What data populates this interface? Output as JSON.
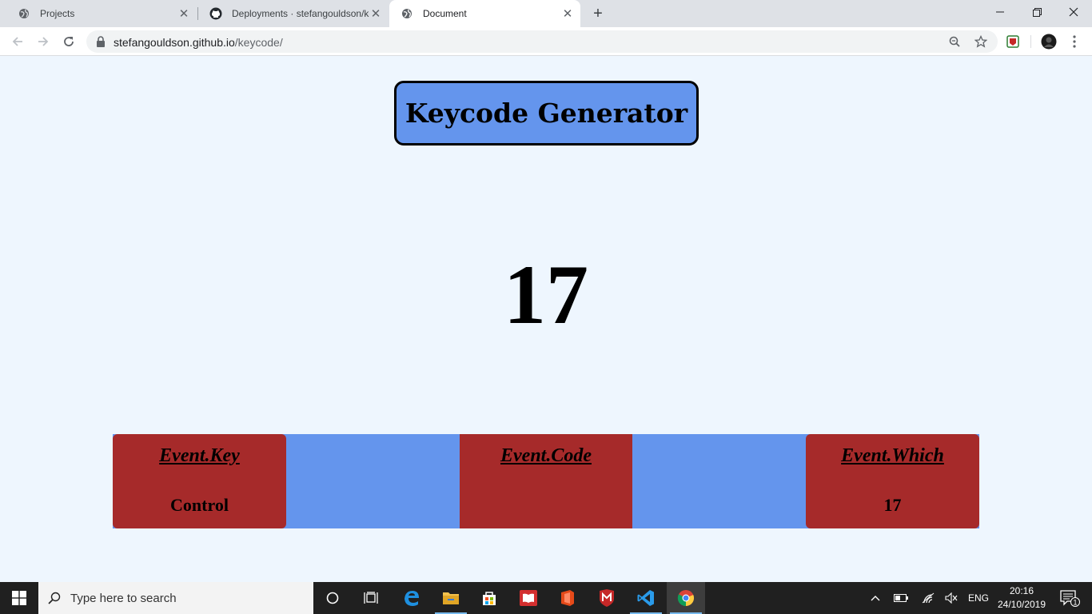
{
  "browser": {
    "tabs": [
      {
        "title": "Projects",
        "favicon": "globe-icon",
        "active": false
      },
      {
        "title": "Deployments · stefangouldson/keycode",
        "favicon": "github-icon",
        "active": false
      },
      {
        "title": "Document",
        "favicon": "globe-icon",
        "active": true
      }
    ],
    "new_tab_label": "+",
    "address": {
      "host": "stefangouldson.github.io",
      "path": "/keycode/"
    }
  },
  "page": {
    "heading": "Keycode Generator",
    "keycode": "17",
    "cards": [
      {
        "label": "Event.Key",
        "value": "Control"
      },
      {
        "label": "Event.Code",
        "value": ""
      },
      {
        "label": "Event.Which",
        "value": "17"
      }
    ],
    "colors": {
      "background": "#eef6fe",
      "accent_blue": "#6495ed",
      "card_red": "#a62a2a"
    }
  },
  "taskbar": {
    "search_placeholder": "Type here to search",
    "apps": [
      "cortana-icon",
      "task-view-icon",
      "edge-icon",
      "file-explorer-icon",
      "store-icon",
      "reader-icon",
      "office-icon",
      "mcafee-icon",
      "vscode-icon",
      "chrome-icon"
    ],
    "language": "ENG",
    "time": "20:16",
    "date": "24/10/2019",
    "notification_count": "1"
  }
}
